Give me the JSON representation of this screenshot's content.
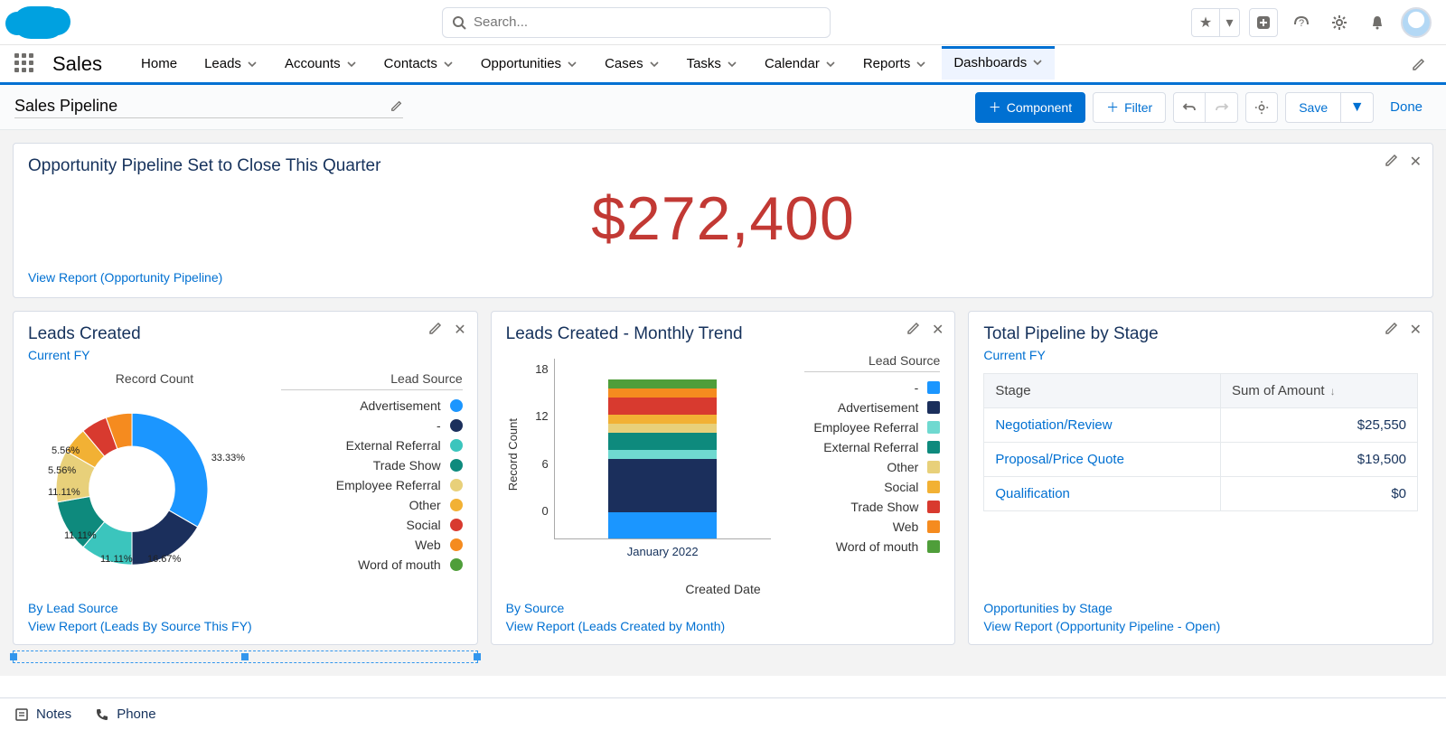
{
  "search": {
    "placeholder": "Search..."
  },
  "app_name": "Sales",
  "nav": [
    "Home",
    "Leads",
    "Accounts",
    "Contacts",
    "Opportunities",
    "Cases",
    "Tasks",
    "Calendar",
    "Reports",
    "Dashboards"
  ],
  "nav_active": "Dashboards",
  "nav_simple": [
    "Home"
  ],
  "dashboard_title": "Sales Pipeline",
  "toolbar": {
    "component": "Component",
    "filter": "Filter",
    "save": "Save",
    "done": "Done"
  },
  "metric_card": {
    "title": "Opportunity Pipeline Set to Close This Quarter",
    "value": "$272,400",
    "view_report": "View Report (Opportunity Pipeline)"
  },
  "donut_card": {
    "title": "Leads Created",
    "subtitle": "Current FY",
    "center_label": "Record Count",
    "legend_title": "Lead Source",
    "footer1": "By Lead Source",
    "footer2": "View Report (Leads By Source This FY)",
    "labels": {
      "a": "33.33%",
      "b": "16.67%",
      "c": "11.11%",
      "d": "11.11%",
      "e": "11.11%",
      "f": "5.56%",
      "g": "5.56%"
    }
  },
  "bar_card": {
    "title": "Leads Created - Monthly Trend",
    "legend_title": "Lead Source",
    "xaxis": "Created Date",
    "yaxis": "Record Count",
    "category": "January 2022",
    "footer1": "By Source",
    "footer2": "View Report (Leads Created by Month)"
  },
  "table_card": {
    "title": "Total Pipeline by Stage",
    "subtitle": "Current FY",
    "col1": "Stage",
    "col2": "Sum of Amount",
    "rows": [
      {
        "stage": "Negotiation/Review",
        "amount": "$25,550"
      },
      {
        "stage": "Proposal/Price Quote",
        "amount": "$19,500"
      },
      {
        "stage": "Qualification",
        "amount": "$0"
      }
    ],
    "footer1": "Opportunities by Stage",
    "footer2": "View Report (Opportunity Pipeline - Open)"
  },
  "utility": {
    "notes": "Notes",
    "phone": "Phone"
  },
  "colors": {
    "Advertisement": "#1b96ff",
    "-": "#1b2f5c",
    "External Referral": "#3bc5bd",
    "Trade Show": "#0e8a7d",
    "Employee Referral": "#e8d07a",
    "Other": "#f2b134",
    "Social": "#d83a2f",
    "Web": "#f58b1f",
    "Word of mouth": "#4f9e3a"
  },
  "bar_colors": {
    "-": "#1b96ff",
    "Advertisement": "#1b2f5c",
    "Employee Referral": "#6fd9d0",
    "External Referral": "#0e8a7d",
    "Other": "#e8d07a",
    "Social": "#f2b134",
    "Trade Show": "#d83a2f",
    "Web": "#f58b1f",
    "Word of mouth": "#4f9e3a"
  },
  "donut_legend": [
    "Advertisement",
    "-",
    "External Referral",
    "Trade Show",
    "Employee Referral",
    "Other",
    "Social",
    "Web",
    "Word of mouth"
  ],
  "bar_legend": [
    "-",
    "Advertisement",
    "Employee Referral",
    "External Referral",
    "Other",
    "Social",
    "Trade Show",
    "Web",
    "Word of mouth"
  ],
  "chart_data": [
    {
      "type": "pie",
      "title": "Leads Created",
      "subtitle": "Current FY",
      "value_label": "Record Count",
      "slices": [
        {
          "label": "Advertisement",
          "pct": 33.33,
          "count": 6
        },
        {
          "label": "-",
          "pct": 16.67,
          "count": 3
        },
        {
          "label": "External Referral",
          "pct": 11.11,
          "count": 2
        },
        {
          "label": "Trade Show",
          "pct": 11.11,
          "count": 2
        },
        {
          "label": "Employee Referral",
          "pct": 11.11,
          "count": 2
        },
        {
          "label": "Other",
          "pct": 5.56,
          "count": 1
        },
        {
          "label": "Social",
          "pct": 5.56,
          "count": 1
        },
        {
          "label": "Web",
          "pct": 5.56,
          "count": 1
        }
      ],
      "total": 18
    },
    {
      "type": "bar",
      "stacked": true,
      "title": "Leads Created - Monthly Trend",
      "xlabel": "Created Date",
      "ylabel": "Record Count",
      "yticks": [
        0,
        6,
        12,
        18
      ],
      "categories": [
        "January 2022"
      ],
      "series": [
        {
          "name": "-",
          "values": [
            3
          ]
        },
        {
          "name": "Advertisement",
          "values": [
            6
          ]
        },
        {
          "name": "Employee Referral",
          "values": [
            1
          ]
        },
        {
          "name": "External Referral",
          "values": [
            2
          ]
        },
        {
          "name": "Other",
          "values": [
            1
          ]
        },
        {
          "name": "Social",
          "values": [
            1
          ]
        },
        {
          "name": "Trade Show",
          "values": [
            2
          ]
        },
        {
          "name": "Web",
          "values": [
            1
          ]
        },
        {
          "name": "Word of mouth",
          "values": [
            1
          ]
        }
      ],
      "total": 18
    },
    {
      "type": "table",
      "title": "Total Pipeline by Stage",
      "columns": [
        "Stage",
        "Sum of Amount"
      ],
      "sort": {
        "column": "Sum of Amount",
        "dir": "desc"
      },
      "rows": [
        [
          "Negotiation/Review",
          25550
        ],
        [
          "Proposal/Price Quote",
          19500
        ],
        [
          "Qualification",
          0
        ]
      ]
    }
  ]
}
